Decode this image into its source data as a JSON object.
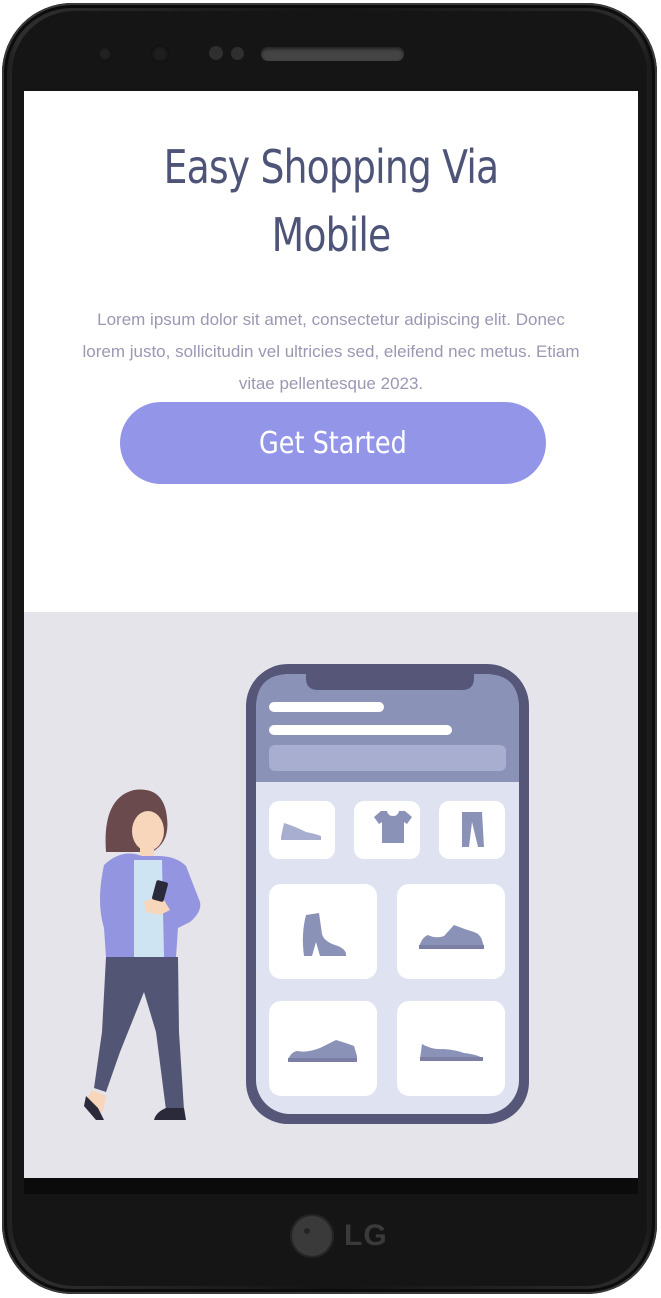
{
  "hero": {
    "title_line1": "Easy Shopping Via",
    "title_line2": "Mobile",
    "description": "Lorem ipsum dolor sit amet, consectetur adipiscing elit. Donec lorem justo, sollicitudin vel ultricies sed, eleifend nec metus. Etiam vitae pellentesque 2023.",
    "cta_label": "Get Started"
  },
  "device": {
    "brand": "LG"
  },
  "illustration": {
    "product_icons": [
      "shoe-flat-icon",
      "tshirt-icon",
      "pants-icon",
      "boot-icon",
      "sneaker-icon",
      "sneaker-icon",
      "sneaker-icon"
    ]
  },
  "colors": {
    "title": "#4e5478",
    "text": "#9a98b3",
    "accent": "#9396e8",
    "illustration_bg": "#e5e4ea",
    "phone_frame": "#565778"
  }
}
